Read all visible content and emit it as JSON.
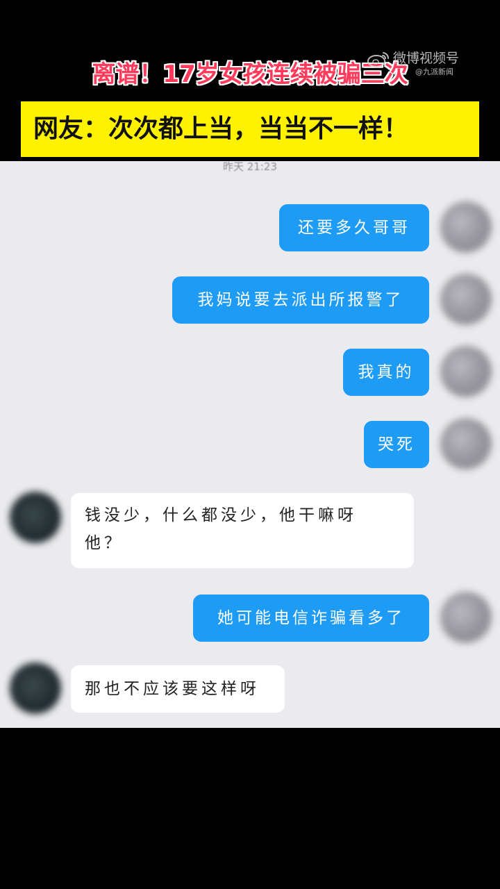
{
  "overlay": {
    "headline": "离谱！17岁女孩连续被骗三次",
    "subheadline": "网友：次次都上当，当当不一样！",
    "colors": {
      "headline": "#ff3b5c",
      "subheadline_bg": "#fff200"
    }
  },
  "watermark": {
    "icon": "weibo-logo-icon",
    "title": "微博视频号",
    "source": "@九派新闻"
  },
  "chat": {
    "timestamp": "昨天 21:23",
    "bubble_colors": {
      "sent": "#1d9bf5",
      "received": "#ffffff"
    },
    "messages": [
      {
        "side": "sent",
        "text": "还要多久哥哥"
      },
      {
        "side": "sent",
        "text": "我妈说要去派出所报警了"
      },
      {
        "side": "sent",
        "text": "我真的"
      },
      {
        "side": "sent",
        "text": "哭死"
      },
      {
        "side": "received",
        "lines": [
          "钱没少，什么都没少，他干嘛呀",
          "他？"
        ]
      },
      {
        "side": "sent",
        "text": "她可能电信诈骗看多了"
      },
      {
        "side": "received",
        "lines": [
          "那也不应该要这样呀"
        ]
      }
    ]
  }
}
